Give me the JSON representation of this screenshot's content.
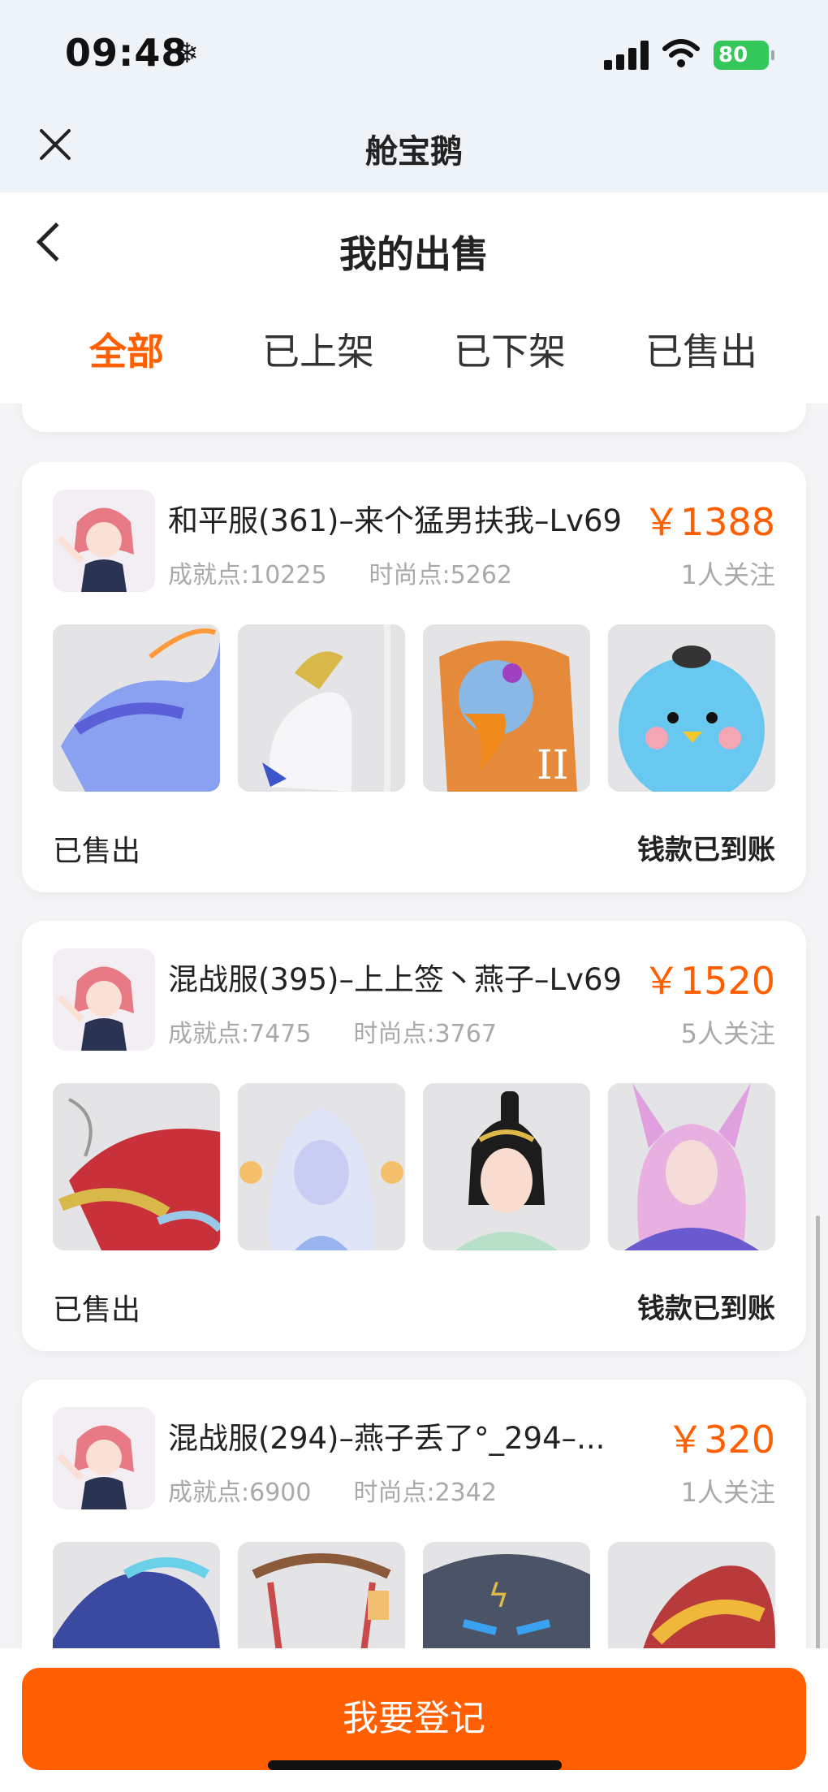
{
  "status_bar": {
    "time": "09:48",
    "snow_glyph": "❄",
    "battery": "80"
  },
  "mini_header": {
    "title": "舱宝鹅"
  },
  "page": {
    "title": "我的出售"
  },
  "tabs": [
    {
      "label": "全部",
      "active": true
    },
    {
      "label": "已上架",
      "active": false
    },
    {
      "label": "已下架",
      "active": false
    },
    {
      "label": "已售出",
      "active": false
    }
  ],
  "listings": [
    {
      "title": "和平服(361)–来个猛男扶我–Lv69",
      "achievement": "成就点:10225",
      "fashion": "时尚点:5262",
      "price": "￥1388",
      "followers": "1人关注",
      "status": "已售出",
      "payout": "钱款已到账",
      "thumbs": [
        "blue-dragon-mount-icon",
        "white-swan-mount-icon",
        "eagle-mount-icon",
        "blue-bird-pet-icon"
      ]
    },
    {
      "title": "混战服(395)–上上签丶燕子–Lv69",
      "achievement": "成就点:7475",
      "fashion": "时尚点:3767",
      "price": "￥1520",
      "followers": "5人关注",
      "status": "已售出",
      "payout": "钱款已到账",
      "thumbs": [
        "red-dragon-mount-icon",
        "white-hair-character-icon",
        "black-hair-character-icon",
        "fox-ear-character-icon"
      ]
    },
    {
      "title": "混战服(294)–燕子丢了°_294–...",
      "achievement": "成就点:6900",
      "fashion": "时尚点:2342",
      "price": "￥320",
      "followers": "1人关注",
      "status": "",
      "payout": "",
      "thumbs": [
        "dark-dragon-mount-icon",
        "red-swing-icon",
        "stone-golem-icon",
        "gold-dragon-icon"
      ]
    }
  ],
  "bottom": {
    "register_label": "我要登记"
  },
  "colors": {
    "accent": "#ff5f00",
    "muted": "#a9a9a9",
    "background": "#f4f4f6"
  }
}
